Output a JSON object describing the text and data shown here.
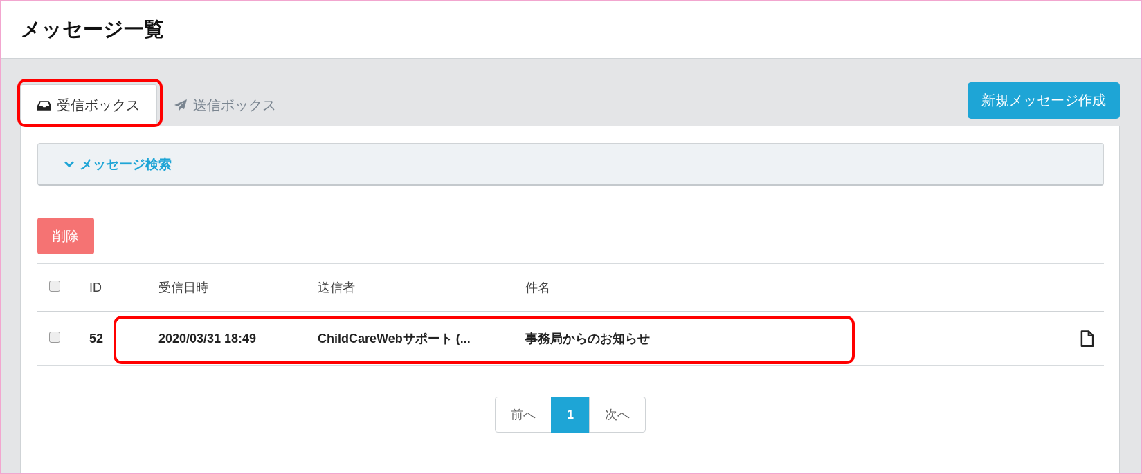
{
  "page": {
    "title": "メッセージ一覧"
  },
  "tabs": [
    {
      "label": "受信ボックス",
      "kind": "inbox",
      "selected": true,
      "highlighted": true
    },
    {
      "label": "送信ボックス",
      "kind": "outbox",
      "selected": false,
      "highlighted": false
    }
  ],
  "new_button": "新規メッセージ作成",
  "search_panel": {
    "label": "メッセージ検索",
    "expanded": false
  },
  "delete_button": "削除",
  "table": {
    "columns": [
      "ID",
      "受信日時",
      "送信者",
      "件名"
    ],
    "select_all_checked": false,
    "rows": [
      {
        "checked": false,
        "id": "52",
        "received": "2020/03/31 18:49",
        "sender": "ChildCareWebサポート (...",
        "subject": "事務局からのお知らせ",
        "highlighted": true
      }
    ]
  },
  "pagination": {
    "prev": "前へ",
    "next": "次へ",
    "pages": [
      {
        "label": "1",
        "selected": true
      }
    ]
  }
}
